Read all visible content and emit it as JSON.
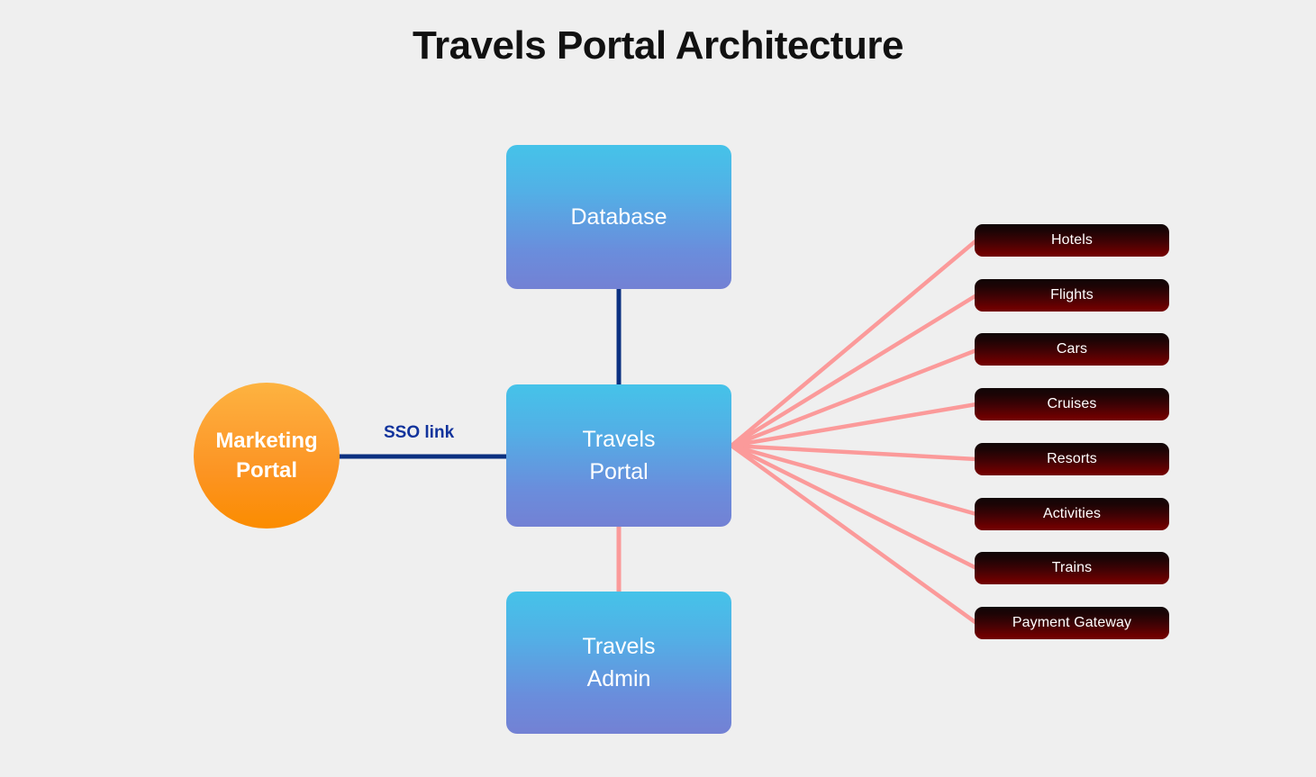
{
  "page": {
    "title": "Travels Portal Architecture",
    "background_color": "#efefef"
  },
  "colors": {
    "node_blue_top": "#45c3e9",
    "node_blue_bottom": "#7381d4",
    "node_orange_top": "#fdb340",
    "node_orange_bottom": "#fb8c00",
    "service_chip_top": "#100607",
    "service_chip_bottom": "#730102",
    "connector_navy": "#0b3080",
    "connector_pink": "#fb9a9a",
    "title_color": "#111111",
    "sso_label_color": "#11339c"
  },
  "nodes": {
    "marketing_portal": {
      "label": "Marketing\nPortal",
      "shape": "circle"
    },
    "database": {
      "label": "Database",
      "shape": "rounded-rect"
    },
    "travels_portal": {
      "label": "Travels\nPortal",
      "shape": "rounded-rect"
    },
    "travels_admin": {
      "label": "Travels\nAdmin",
      "shape": "rounded-rect"
    }
  },
  "edges": {
    "sso_link": {
      "label": "SSO link",
      "from": "marketing_portal",
      "to": "travels_portal",
      "color": "#0b3080"
    },
    "database_link": {
      "from": "database",
      "to": "travels_portal",
      "color": "#0b3080"
    },
    "admin_link": {
      "from": "travels_portal",
      "to": "travels_admin",
      "color": "#fb9a9a"
    }
  },
  "services": [
    {
      "label": "Hotels"
    },
    {
      "label": "Flights"
    },
    {
      "label": "Cars"
    },
    {
      "label": "Cruises"
    },
    {
      "label": "Resorts"
    },
    {
      "label": "Activities"
    },
    {
      "label": "Trains"
    },
    {
      "label": "Payment Gateway"
    }
  ]
}
